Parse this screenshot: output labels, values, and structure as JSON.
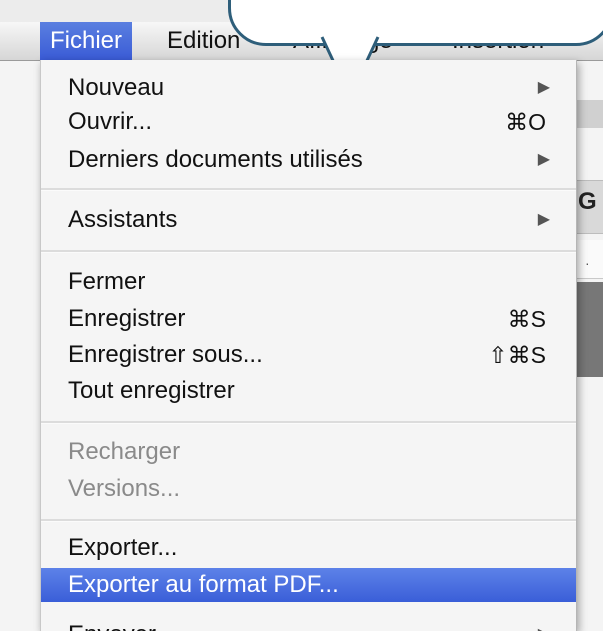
{
  "menubar": {
    "items": [
      {
        "label": "Fichier"
      },
      {
        "label": "Edition"
      },
      {
        "label": "Affichage"
      },
      {
        "label": "Insertion"
      }
    ]
  },
  "background": {
    "partial_letter": "G",
    "ruler_mark": "·"
  },
  "menu": {
    "items": [
      {
        "label": "Nouveau",
        "submenu_arrow": "▶"
      },
      {
        "label": "Ouvrir...",
        "shortcut": "⌘O"
      },
      {
        "label": "Derniers documents utilisés",
        "submenu_arrow": "▶"
      },
      {
        "label": "Assistants",
        "submenu_arrow": "▶"
      },
      {
        "label": "Fermer"
      },
      {
        "label": "Enregistrer",
        "shortcut": "⌘S"
      },
      {
        "label": "Enregistrer sous...",
        "shortcut": "⇧⌘S"
      },
      {
        "label": "Tout enregistrer"
      },
      {
        "label": "Recharger",
        "state": "disabled"
      },
      {
        "label": "Versions...",
        "state": "disabled"
      },
      {
        "label": "Exporter..."
      },
      {
        "label": "Exporter au format PDF...",
        "state": "highlighted"
      },
      {
        "label": "Envoyer",
        "submenu_arrow": "▶"
      }
    ]
  },
  "colors": {
    "highlight": "#3a5ed8",
    "callout_border": "#2e5e7a"
  }
}
